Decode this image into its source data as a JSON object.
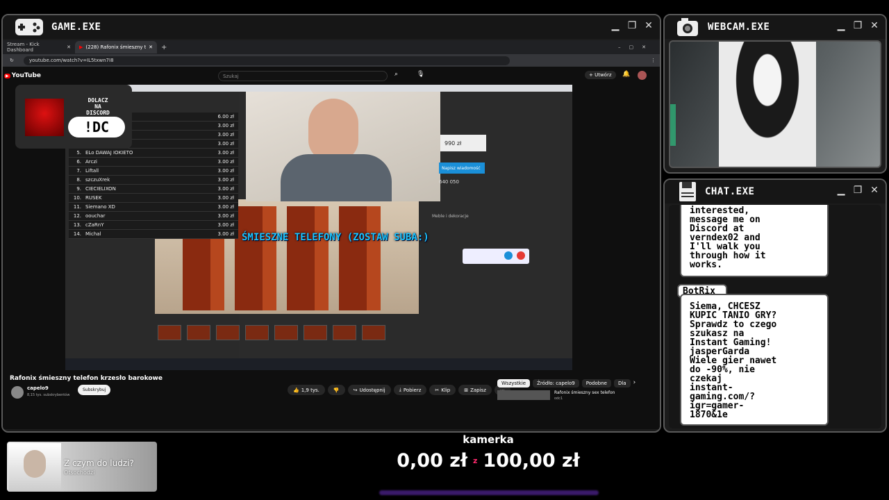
{
  "game_window": {
    "title": "GAME.EXE"
  },
  "webcam_window": {
    "title": "WEBCAM.EXE"
  },
  "chat_window": {
    "title": "CHAT.EXE",
    "message1": "interested,\nmessage me on\nDiscord at\nverndex02 and\nI'll walk you\nthrough how it\nworks.",
    "bot_name": "BotRix",
    "message2": "Siema, CHCESZ\nKUPIC TANIO GRY?\nSprawdz to czego\nszukasz na\nInstant Gaming!\njasperGarda\nWiele gier nawet\ndo -90%, nie\nczekaj",
    "message2b": "instant-\ngaming.com/?\nigr=gamer-\n1870&1e"
  },
  "browser": {
    "tabs": [
      {
        "label": "Stream - Kick Dashboard"
      },
      {
        "label": "(228) Rafonix śmieszny telef"
      }
    ],
    "url": "youtube.com/watch?v=IL5txwn7I8"
  },
  "youtube": {
    "logo": "YouTube",
    "search_placeholder": "Szukaj",
    "create_label": "Utwórz",
    "video_title": "Rafonix śmieszny telefon krzesło barokowe",
    "channel_name": "capelo9",
    "subscribers": "8,15 tys. subskrybentów",
    "subscribe_label": "Subskrybuj",
    "likes": "1,9 tys.",
    "share_label": "Udostępnij",
    "download_label": "Pobierz",
    "clip_label": "Klip",
    "save_label": "Zapisz",
    "chips": [
      "Wszystkie",
      "Źródło: capelo9",
      "Podobne",
      "Dla"
    ],
    "next_video_title": "Rafonix śmieszny sex telefon",
    "next_video_sub": "odc1"
  },
  "video_overlay": {
    "discord_line1": "DOLACZ",
    "discord_line2": "NA",
    "discord_line3": "DISCORD",
    "discord_cmd": "!DC",
    "caption": "ŚMIESZNE TELEFONY (ZOSTAW SUBA:)",
    "price": "990 zł",
    "send_msg": "Napisz wiadomość",
    "phone_number": "640 050",
    "category": "Meble i dekoracje",
    "rankings": [
      {
        "n": "",
        "name": "",
        "value": "6.00 zł"
      },
      {
        "n": "",
        "name": "",
        "value": "3.00 zł"
      },
      {
        "n": "",
        "name": "",
        "value": "3.00 zł"
      },
      {
        "n": "",
        "name": "",
        "value": "3.00 zł"
      },
      {
        "n": "5.",
        "name": "ELo DAWAJ IOKIETO",
        "value": "3.00 zł"
      },
      {
        "n": "6.",
        "name": "Arczi",
        "value": "3.00 zł"
      },
      {
        "n": "7.",
        "name": "Liftall",
        "value": "3.00 zł"
      },
      {
        "n": "8.",
        "name": "szczuXrek",
        "value": "3.00 zł"
      },
      {
        "n": "9.",
        "name": "CIECIELIXON",
        "value": "3.00 zł"
      },
      {
        "n": "10.",
        "name": "RUSEK",
        "value": "3.00 zł"
      },
      {
        "n": "11.",
        "name": "Siemano XD",
        "value": "3.00 zł"
      },
      {
        "n": "12.",
        "name": "oouchar",
        "value": "3.00 zł"
      },
      {
        "n": "13.",
        "name": "cZaRnY",
        "value": "3.00 zł"
      },
      {
        "n": "14.",
        "name": "Michal",
        "value": "3.00 zł"
      }
    ]
  },
  "song_widget": {
    "title": "Z czym do ludzi?",
    "artist": "Otsochodzi"
  },
  "goal_widget": {
    "label": "kamerka",
    "current": "0,00 zł",
    "separator": "z",
    "target": "100,00 zł",
    "progress": 0
  },
  "colors": {
    "accent_cyan": "#19c2ff",
    "goal_separator": "#ff2a6d",
    "goal_bar": "#4a1a8a"
  }
}
